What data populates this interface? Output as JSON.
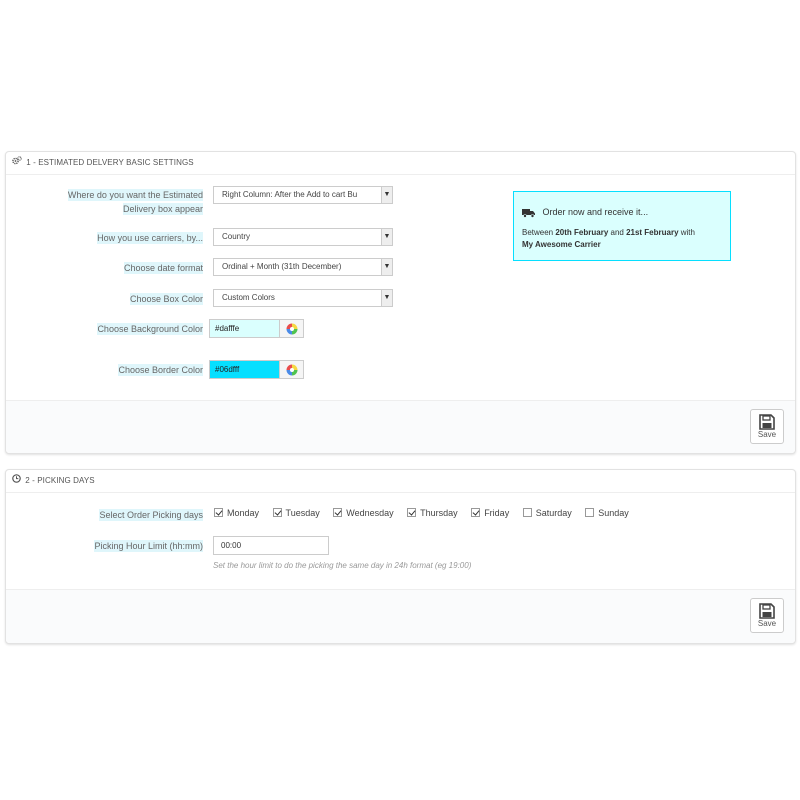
{
  "section1": {
    "title": "1 - ESTIMATED DELVERY BASIC SETTINGS",
    "location_label_line1": "Where do you want the Estimated",
    "location_label_line2": "Delivery box appear",
    "location_value": "Right Column: After the Add to cart Bu",
    "carriers_label": "How you use carriers, by...",
    "carriers_value": "Country",
    "date_format_label": "Choose date format",
    "date_format_value": "Ordinal + Month (31th December)",
    "box_color_label": "Choose Box Color",
    "box_color_value": "Custom Colors",
    "bg_color_label": "Choose Background Color",
    "bg_color_value": "#dafffe",
    "border_color_label": "Choose Border Color",
    "border_color_value": "#06dfff",
    "save_label": "Save",
    "preview": {
      "title": "Order now and receive it...",
      "text_before": "Between ",
      "date_from": "20th February",
      "text_and": " and ",
      "date_to": "21st February",
      "text_with": " with",
      "carrier": "My Awesome Carrier"
    }
  },
  "section2": {
    "title": "2 - PICKING DAYS",
    "picking_days_label": "Select Order Picking days",
    "days": [
      {
        "label": "Monday",
        "checked": true
      },
      {
        "label": "Tuesday",
        "checked": true
      },
      {
        "label": "Wednesday",
        "checked": true
      },
      {
        "label": "Thursday",
        "checked": true
      },
      {
        "label": "Friday",
        "checked": true
      },
      {
        "label": "Saturday",
        "checked": false
      },
      {
        "label": "Sunday",
        "checked": false
      }
    ],
    "hour_limit_label": "Picking Hour Limit (hh:mm)",
    "hour_limit_value": "00:00",
    "hour_limit_help": "Set the hour limit to do the picking the same day in 24h format (eg 19:00)",
    "save_label": "Save"
  },
  "colors": {
    "accent_bg": "#dafffe",
    "accent_border": "#06dfff",
    "label_highlight": "#dff6fb"
  },
  "icons": {
    "section1": "cogs-icon",
    "section2": "clock-icon",
    "save": "floppy-disk-icon",
    "color_picker": "color-wheel-icon",
    "preview": "truck-icon"
  }
}
